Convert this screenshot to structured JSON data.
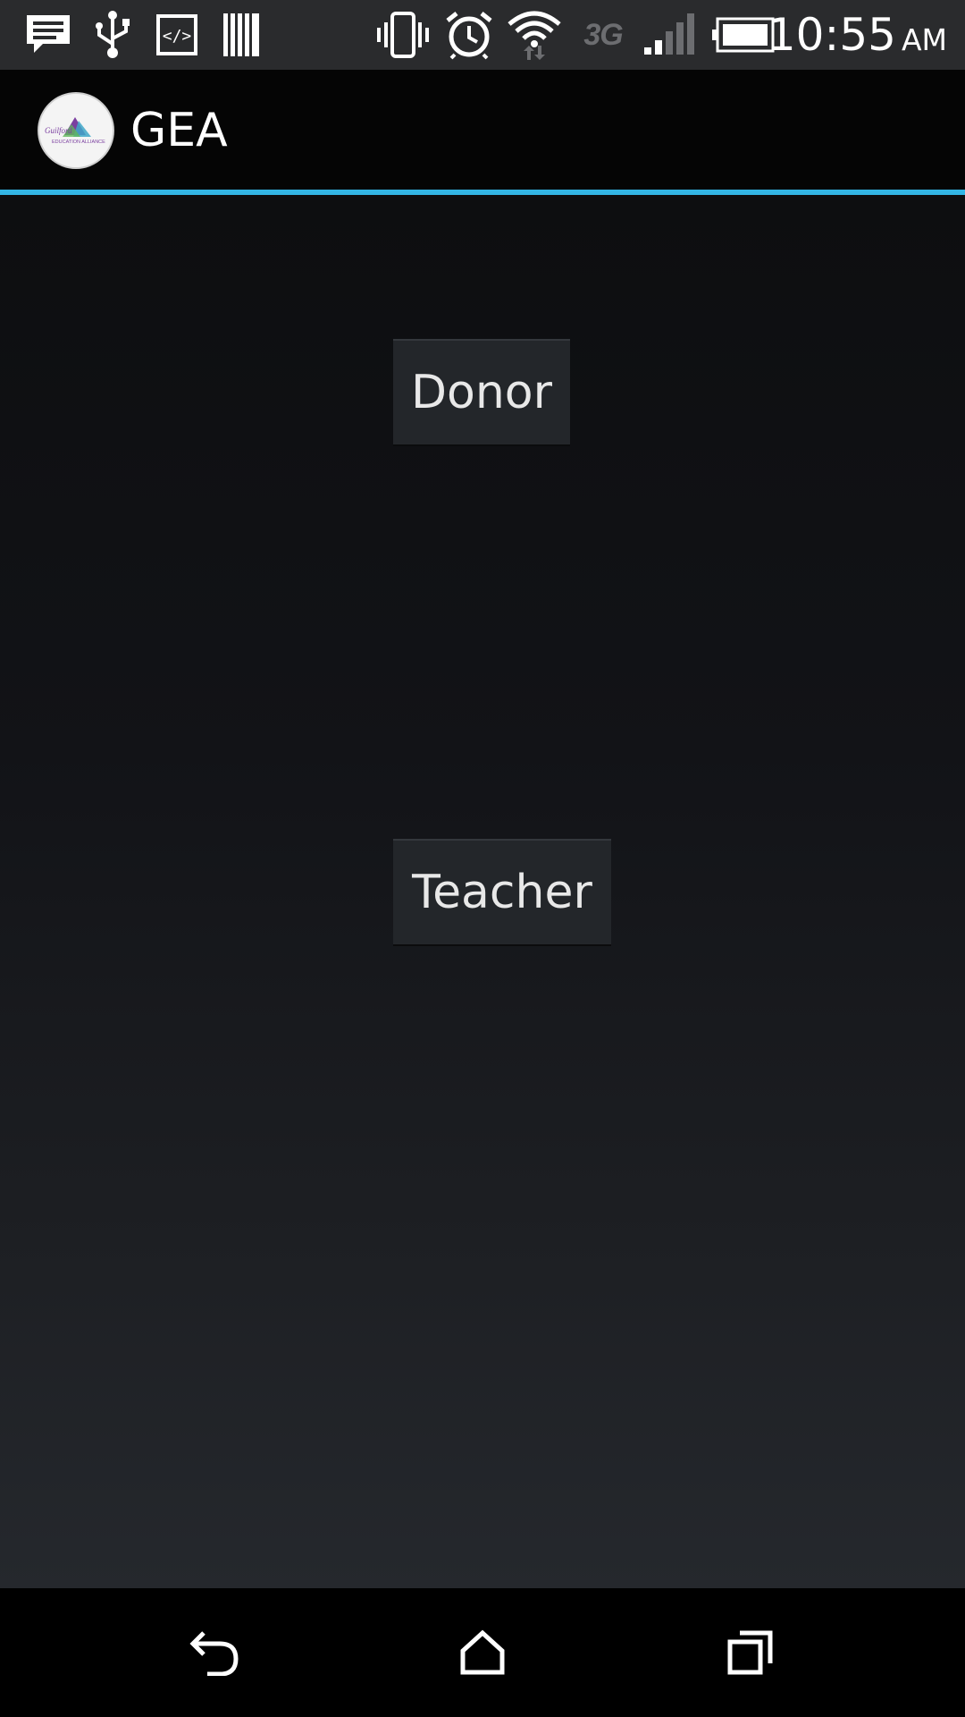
{
  "status_bar": {
    "left_icons": [
      "message-icon",
      "usb-icon",
      "developer-code-icon",
      "barcode-icon"
    ],
    "right_icons": [
      "vibrate-icon",
      "alarm-icon",
      "wifi-icon",
      "signal-icon",
      "battery-icon"
    ],
    "network_type": "3G",
    "time": "10:55",
    "ampm": "AM"
  },
  "action_bar": {
    "title": "GEA",
    "accent_color": "#33b5e5"
  },
  "buttons": {
    "donor_label": "Donor",
    "teacher_label": "Teacher"
  },
  "nav_bar": {
    "icons": [
      "back-icon",
      "home-icon",
      "recent-apps-icon"
    ]
  }
}
